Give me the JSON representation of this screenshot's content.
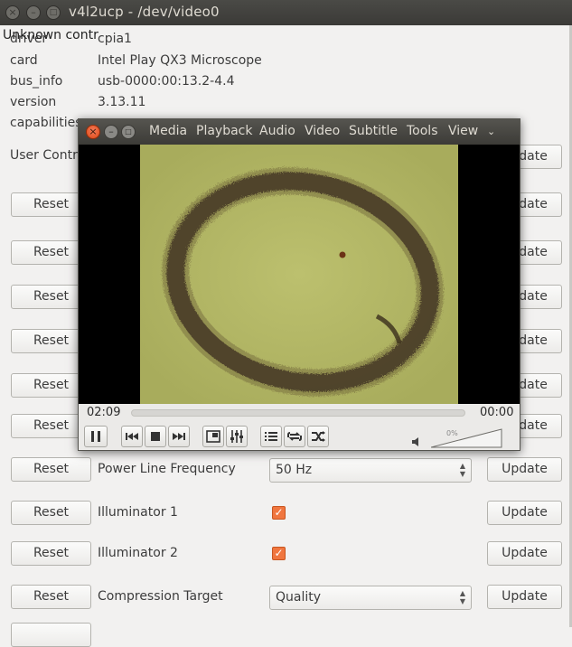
{
  "window": {
    "title": "v4l2ucp - /dev/video0",
    "overlay_text": "Unknown contr"
  },
  "info": [
    {
      "label": "driver",
      "value": "cpia1"
    },
    {
      "label": "card",
      "value": "Intel Play QX3 Microscope"
    },
    {
      "label": "bus_info",
      "value": "usb-0000:00:13.2-4.4"
    },
    {
      "label": "version",
      "value": "3.13.11"
    },
    {
      "label": "capabilities",
      "value": ""
    }
  ],
  "section": {
    "user_controls": "User Contro"
  },
  "buttons": {
    "reset": "Reset",
    "update": "Update"
  },
  "controls": [
    {
      "label": "Power Line Frequency",
      "kind": "combo",
      "value": "50 Hz"
    },
    {
      "label": "Illuminator 1",
      "kind": "checkbox",
      "checked": true
    },
    {
      "label": "Illuminator 2",
      "kind": "checkbox",
      "checked": true
    },
    {
      "label": "Compression Target",
      "kind": "combo",
      "value": "Quality"
    }
  ],
  "vlc": {
    "menu": [
      "Media",
      "Playback",
      "Audio",
      "Video",
      "Subtitle",
      "Tools",
      "View"
    ],
    "elapsed": "02:09",
    "remaining": "00:00",
    "volume_percent": "0%",
    "video_content": "microscope view: dark brown oval ring on yellow-green background"
  },
  "colors": {
    "accent_checkbox": "#f0763f",
    "vlc_close": "#dd4814",
    "titlebar": "#3c3b37",
    "video_bg": "#b2b665"
  }
}
